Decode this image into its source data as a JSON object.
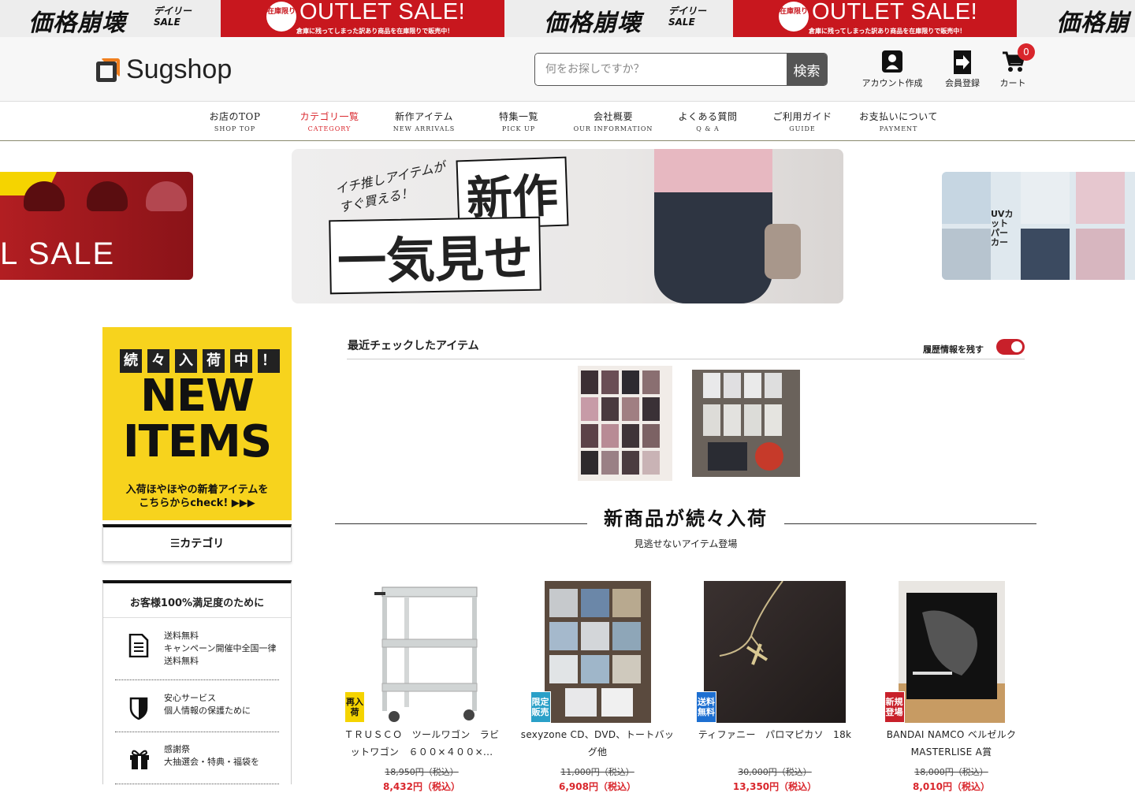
{
  "banner": {
    "daily_sale_text": "価格崩壊",
    "daily_sale_sub": "デイリーSALE",
    "outlet_badge": "在庫限り",
    "outlet_text": "OUTLET SALE!",
    "outlet_sub": "倉庫に残ってしまった訳あり商品を在庫限りで販売中！",
    "colors": {
      "red": "#c8171e",
      "gray": "#ededed"
    }
  },
  "header": {
    "logo_text": "Sugshop",
    "search_placeholder": "何をお探しですか？",
    "search_button": "検索",
    "account_label": "アカウント作成",
    "member_label": "会員登録",
    "cart_label": "カート",
    "cart_count": "0",
    "icons": [
      "account-icon",
      "login-icon",
      "cart-icon"
    ]
  },
  "nav": {
    "items": [
      {
        "ja": "お店のTOP",
        "en": "SHOP TOP"
      },
      {
        "ja": "カテゴリ一覧",
        "en": "CATEGORY"
      },
      {
        "ja": "新作アイテム",
        "en": "NEW ARRIVALS"
      },
      {
        "ja": "特集一覧",
        "en": "PICK UP"
      },
      {
        "ja": "会社概要",
        "en": "OUR INFORMATION"
      },
      {
        "ja": "よくある質問",
        "en": "Q & A"
      },
      {
        "ja": "ご利用ガイド",
        "en": "GUIDE"
      },
      {
        "ja": "お支払いについて",
        "en": "PAYMENT"
      }
    ],
    "active_index": 1,
    "active_color": "#d9262c"
  },
  "carousel": {
    "left_text": "L SALE",
    "center_small": "イチ推しアイテムがすぐ買える！",
    "center_big1": "新作",
    "center_big2": "一気見せ",
    "right_text": "UVカットパーカー"
  },
  "sidebar": {
    "new_chars": [
      "続",
      "々",
      "入",
      "荷",
      "中",
      "！"
    ],
    "new_line1": "NEW",
    "new_line2": "ITEMS",
    "new_sub1": "入荷ほやほやの新着アイテムを",
    "new_sub2": "こちらからcheck! ▶▶▶",
    "category_label": "☰カテゴリ",
    "satisfaction_title": "お客様100%満足度のために",
    "features": [
      {
        "icon": "document-icon",
        "title": "送料無料",
        "text": "キャンペーン開催中全国一律送料無料"
      },
      {
        "icon": "shield-icon",
        "title": "安心サービス",
        "text": "個人情報の保護ために"
      },
      {
        "icon": "gift-icon",
        "title": "感謝祭",
        "text": "大抽選会・特典・福袋を"
      }
    ]
  },
  "recent": {
    "title": "最近チェックしたアイテム",
    "history_label": "履歴情報を残す",
    "history_enabled": true
  },
  "new_section": {
    "title": "新商品が続々入荷",
    "subtitle": "見逃せないアイテム登場"
  },
  "products": [
    {
      "tag": "再入荷",
      "tag_color": "#f5d400",
      "name": "ＴＲＵＳＣＯ　ツールワゴン　ラビットワゴン　６００×４００×...",
      "old_price": "18,950円（税込）",
      "price": "8,432円（税込）"
    },
    {
      "tag": "限定販売",
      "tag_color": "#2aa0c8",
      "name": "sexyzone CD、DVD、トートバッグ他",
      "old_price": "11,000円（税込）",
      "price": "6,908円（税込）"
    },
    {
      "tag": "送料無料",
      "tag_color": "#1d6fd1",
      "name": "ティファニー　パロマピカソ　18k",
      "old_price": "30,000円（税込）",
      "price": "13,350円（税込）"
    },
    {
      "tag": "新規登場",
      "tag_color": "#c8202a",
      "name": "BANDAI NAMCO ベルゼルク MASTERLISE A賞",
      "old_price": "18,000円（税込）",
      "price": "8,010円（税込）"
    }
  ]
}
